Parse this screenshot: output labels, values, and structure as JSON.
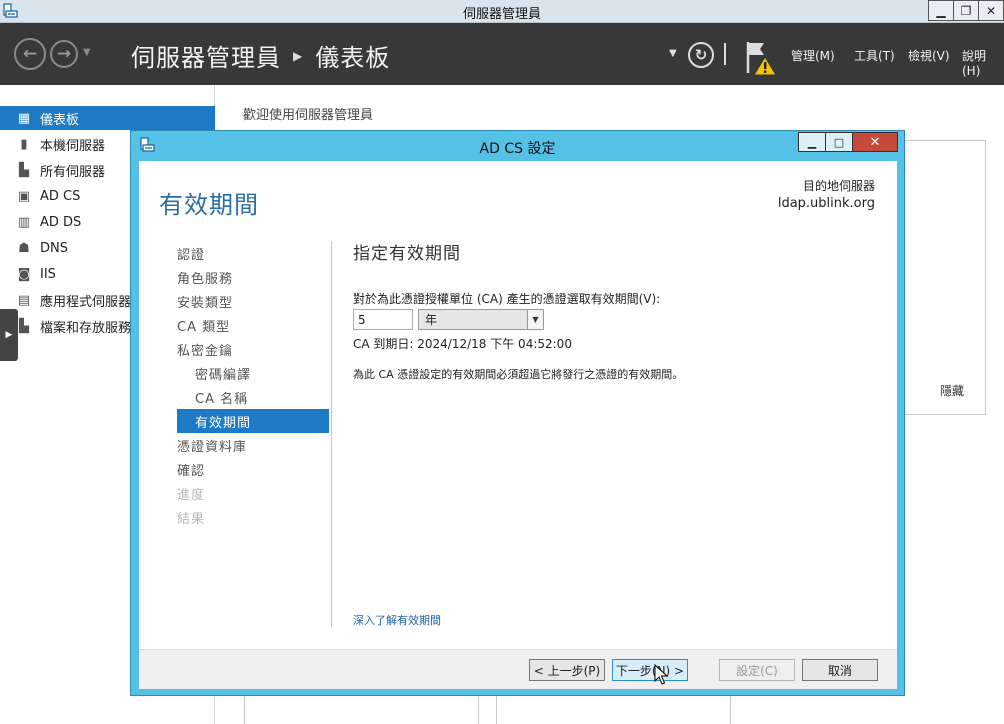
{
  "window": {
    "title": "伺服器管理員"
  },
  "header": {
    "breadcrumb_root": "伺服器管理員",
    "breadcrumb_current": "儀表板",
    "menus": [
      "管理(M)",
      "工具(T)",
      "檢視(V)",
      "說明(H)"
    ]
  },
  "sidebar": {
    "items": [
      {
        "label": "儀表板"
      },
      {
        "label": "本機伺服器"
      },
      {
        "label": "所有伺服器"
      },
      {
        "label": "AD CS"
      },
      {
        "label": "AD DS"
      },
      {
        "label": "DNS"
      },
      {
        "label": "IIS"
      },
      {
        "label": "應用程式伺服器"
      },
      {
        "label": "檔案和存放服務"
      }
    ]
  },
  "main": {
    "welcome": "歡迎使用伺服器管理員",
    "hide_label": "隱藏"
  },
  "dialog": {
    "title": "AD CS 設定",
    "page_heading": "有效期間",
    "dest_label": "目的地伺服器",
    "dest_value": "ldap.ublink.org",
    "steps": [
      "認證",
      "角色服務",
      "安裝類型",
      "CA 類型",
      "私密金鑰",
      "密碼編譯",
      "CA 名稱",
      "有效期間",
      "憑證資料庫",
      "確認",
      "進度",
      "結果"
    ],
    "section_title": "指定有效期間",
    "period_label": "對於為此憑證授權單位 (CA) 產生的憑證選取有效期間(V):",
    "period_value": "5",
    "period_unit": "年",
    "expiry": "CA 到期日: 2024/12/18 下午 04:52:00",
    "note": "為此 CA 憑證設定的有效期間必須超過它將發行之憑證的有效期間。",
    "learn_link": "深入了解有效期間",
    "buttons": {
      "prev": "< 上一步(P)",
      "next": "下一步(N) >",
      "configure": "設定(C)",
      "cancel": "取消"
    }
  }
}
